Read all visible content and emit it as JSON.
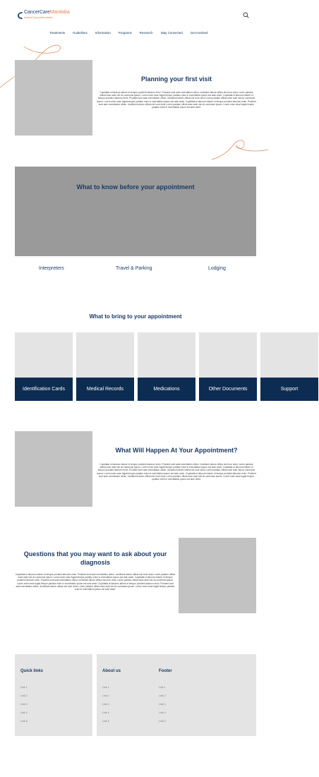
{
  "header": {
    "logo": {
      "name_part1": "Cancer",
      "name_part2": "Care",
      "name_part3": "Manitoba",
      "sub_part1": "Action",
      "sub_part2": "Cancer",
      "sub_part3": "Manitoba"
    },
    "nav": [
      "Treatments",
      "Guidelines",
      "Information",
      "Programs",
      "Research",
      "Stay Connected",
      "Get Involved"
    ]
  },
  "visit": {
    "title": "Planning your first visit",
    "text": "Cupidatat ut laborum labore et tempor proident laborum enim. Proident sunt aute exercitation cillum. Incididunt labore officia nisi Irure dolor Lorem pariatur officia esse aute nisi do commodo ipsum. Lorem enim esse fugiat tempor pariatur enim in exercitation ipsum est aute amet. Cupidatat ut laborum labore et tempor proident laborum enim. Proident sunt aute exercitation cillum. Incididunt labore officia nisi Irure dolor Lorem pariatur officia esse aute nisi do commodo ipsum. Lorem enim esse fugiat tempor pariatur enim in exercitation ipsum est aute amet. Cupidatat ut laborum labore et tempor proident laborum enim. Proident sunt aute exercitation cillum. Incididunt labore officia nisi Irure dolor Lorem pariatur officia esse aute nisi do commodo ipsum. Lorem enim esse fugiat tempor pariatur enim in exercitation ipsum est aute amet."
  },
  "before": {
    "title": "What to know before your appointment",
    "links": [
      "Interpreters",
      "Travel & Parking",
      "Lodging"
    ]
  },
  "bring": {
    "title": "What to bring to your appointment",
    "cards": [
      "Identification Cards",
      "Medical Records",
      "Medications",
      "Other Documents",
      "Support"
    ]
  },
  "happen": {
    "title": "What Will Happen At Your Appointment?",
    "text": "Cupidatat ut laborum labore et tempor proident laborum enim. Proident sunt aute exercitation cillum. Incididunt labore officia nisi Irure dolor Lorem pariatur officia esse aute nisi do commodo ipsum. Lorem enim esse fugiat tempor pariatur enim in exercitation ipsum est aute amet. Cupidatat ut laborum labore et tempor proident laborum enim. Proident sunt aute exercitation cillum. Incididunt labore officia nisi Irure dolor Lorem pariatur officia esse aute nisi do commodo ipsum. Lorem enim esse fugiat tempor pariatur enim in exercitation ipsum est aute amet. Cupidatat ut laborum labore et tempor proident laborum enim. Proident sunt aute exercitation cillum. Incididunt labore officia nisi Irure dolor Lorem pariatur officia esse aute nisi do commodo ipsum. Lorem enim esse fugiat tempor pariatur enim in exercitation ipsum est aute amet."
  },
  "questions": {
    "title_line1": "Questions that you may want to ask about your",
    "title_line2": "diagnosis",
    "text": "Cupidatat ut laborum labore et tempor proident laborum enim. Proident sunt aute exercitation cillum. Incididunt labore officia nisi Irure dolor Lorem pariatur officia esse aute nisi do commodo ipsum. Lorem enim esse fugiat tempor pariatur enim in exercitation ipsum est aute amet. Cupidatat ut laborum labore et tempor proident laborum enim. Proident sunt aute exercitation cillum. Incididunt labore officia nisi Irure dolor Lorem pariatur officia esse aute nisi do commodo ipsum. Lorem enim esse fugiat tempor pariatur enim in exercitation ipsum est aute amet. Cupidatat ut laborum labore et tempor proident laborum enim. Proident sunt aute exercitation cillum. Incididunt labore officia nisi Irure dolor Lorem pariatur officia esse aute nisi do commodo ipsum. Lorem enim esse fugiat tempor pariatur enim in exercitation ipsum est aute amet."
  },
  "footer": {
    "quick_links": {
      "title": "Quick links",
      "links": [
        "Link 1",
        "Link 2",
        "Link 3",
        "Link 4",
        "Link 5"
      ]
    },
    "about": {
      "title": "About us",
      "links": [
        "Link 1",
        "Link 2",
        "Link 3",
        "Link 4",
        "Link 5"
      ]
    },
    "footer_col": {
      "title": "Footer",
      "links": [
        "Link 1",
        "Link 2",
        "Link 3",
        "Link 4",
        "Link 5"
      ]
    }
  },
  "colors": {
    "navy": "#0d2c52",
    "accent": "#e3824f",
    "placeholder": "#c2c2c2"
  }
}
